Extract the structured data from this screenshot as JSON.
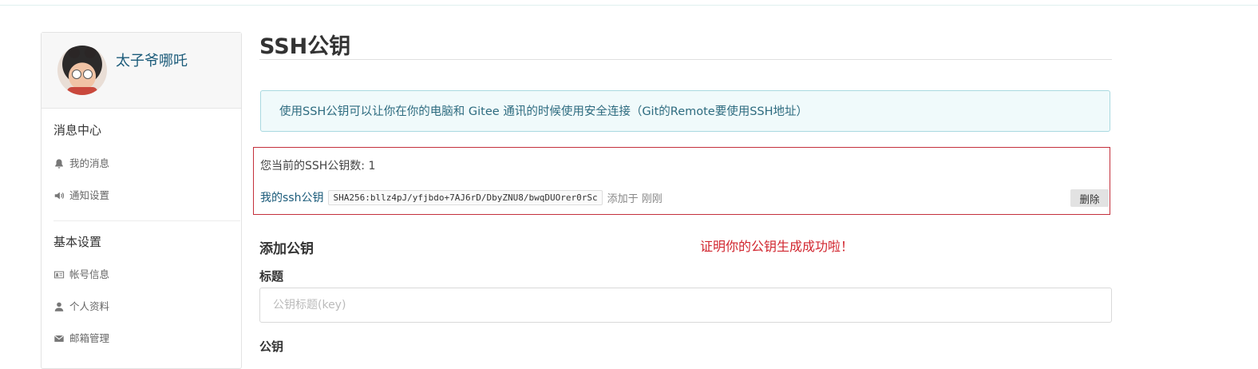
{
  "sidebar": {
    "user_name": "太子爷哪吒",
    "sections": [
      {
        "title": "消息中心",
        "items": [
          {
            "label": "我的消息",
            "icon": "bell-icon"
          },
          {
            "label": "通知设置",
            "icon": "speaker-icon"
          }
        ]
      },
      {
        "title": "基本设置",
        "items": [
          {
            "label": "帐号信息",
            "icon": "id-card-icon"
          },
          {
            "label": "个人资料",
            "icon": "user-icon"
          },
          {
            "label": "邮箱管理",
            "icon": "envelope-icon"
          }
        ]
      }
    ]
  },
  "main": {
    "title": "SSH公钥",
    "info": "使用SSH公钥可以让你在你的电脑和 Gitee 通讯的时候使用安全连接（Git的Remote要使用SSH地址）",
    "key_count_text": "您当前的SSH公钥数: 1",
    "key": {
      "name": "我的ssh公钥",
      "fingerprint": "SHA256:bllz4pJ/yfjbdo+7AJ6rD/DbyZNU8/bwqDUOrer0rSc",
      "added": "添加于 刚刚",
      "delete_label": "删除"
    },
    "add_title": "添加公钥",
    "success_note": "证明你的公钥生成成功啦！",
    "title_label": "标题",
    "title_placeholder": "公钥标题(key)",
    "key_label": "公钥"
  },
  "colors": {
    "accent_link": "#1b5b7a",
    "error_red": "#d1262f",
    "info_bg": "#f0fafb"
  }
}
